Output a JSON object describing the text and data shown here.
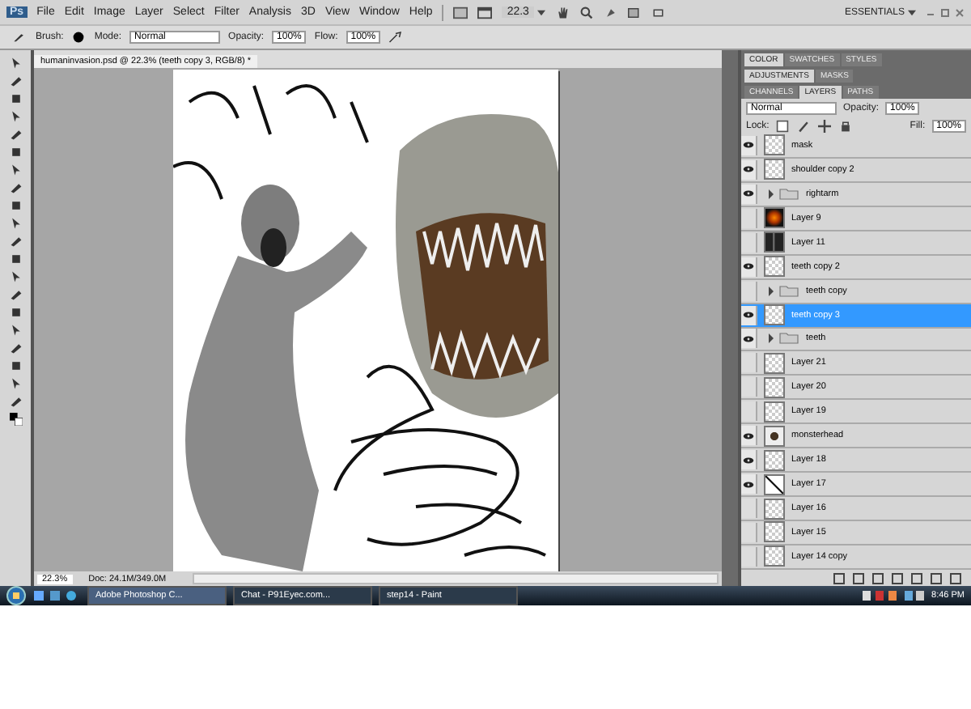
{
  "app": {
    "logo": "Ps",
    "menus": [
      "File",
      "Edit",
      "Image",
      "Layer",
      "Select",
      "Filter",
      "Analysis",
      "3D",
      "View",
      "Window",
      "Help"
    ],
    "zoom": "22.3",
    "workspace": "ESSENTIALS"
  },
  "options": {
    "brush_label": "Brush:",
    "mode_label": "Mode:",
    "mode": "Normal",
    "opacity_label": "Opacity:",
    "opacity": "100%",
    "flow_label": "Flow:",
    "flow": "100%"
  },
  "document": {
    "tab": "humaninvasion.psd @ 22.3% (teeth copy 3, RGB/8) *",
    "zoom": "22.3%",
    "info": "Doc: 24.1M/349.0M"
  },
  "panel_groups": [
    [
      {
        "label": "COLOR",
        "selected": true
      },
      {
        "label": "SWATCHES",
        "selected": false
      },
      {
        "label": "STYLES",
        "selected": false
      }
    ],
    [
      {
        "label": "ADJUSTMENTS",
        "selected": true
      },
      {
        "label": "MASKS",
        "selected": false
      }
    ],
    [
      {
        "label": "CHANNELS",
        "selected": false
      },
      {
        "label": "LAYERS",
        "selected": true
      },
      {
        "label": "PATHS",
        "selected": false
      }
    ]
  ],
  "layers_panel": {
    "blend": "Normal",
    "opacity_label": "Opacity:",
    "opacity": "100%",
    "lock_label": "Lock:",
    "fill_label": "Fill:",
    "fill": "100%",
    "layers": [
      {
        "kind": "blank",
        "name": "mask",
        "visible": true,
        "selected": false
      },
      {
        "kind": "blank",
        "name": "shoulder copy 2",
        "visible": true,
        "selected": false
      },
      {
        "kind": "group",
        "name": "rightarm",
        "visible": true,
        "selected": false
      },
      {
        "kind": "fire",
        "name": "Layer 9",
        "visible": false,
        "selected": false
      },
      {
        "kind": "dark",
        "name": "Layer 11",
        "visible": false,
        "selected": false
      },
      {
        "kind": "blank",
        "name": "teeth copy 2",
        "visible": true,
        "selected": false
      },
      {
        "kind": "group",
        "name": "teeth copy",
        "visible": false,
        "selected": false
      },
      {
        "kind": "blank",
        "name": "teeth copy 3",
        "visible": true,
        "selected": true
      },
      {
        "kind": "group",
        "name": "teeth",
        "visible": true,
        "selected": false
      },
      {
        "kind": "blank",
        "name": "Layer 21",
        "visible": false,
        "selected": false
      },
      {
        "kind": "blank",
        "name": "Layer 20",
        "visible": false,
        "selected": false
      },
      {
        "kind": "blank",
        "name": "Layer 19",
        "visible": false,
        "selected": false
      },
      {
        "kind": "head",
        "name": "monsterhead",
        "visible": true,
        "selected": false
      },
      {
        "kind": "blank",
        "name": "Layer 18",
        "visible": true,
        "selected": false
      },
      {
        "kind": "sketch",
        "name": "Layer 17",
        "visible": true,
        "selected": false
      },
      {
        "kind": "blank",
        "name": "Layer 16",
        "visible": false,
        "selected": false
      },
      {
        "kind": "blank",
        "name": "Layer 15",
        "visible": false,
        "selected": false
      },
      {
        "kind": "blank",
        "name": "Layer 14 copy",
        "visible": false,
        "selected": false
      }
    ]
  },
  "taskbar": {
    "tasks": [
      {
        "label": "Adobe Photoshop C...",
        "selected": true
      },
      {
        "label": "Chat - P91Eyec.com...",
        "selected": false
      },
      {
        "label": "step14 - Paint",
        "selected": false
      }
    ],
    "clock": "8:46 PM"
  }
}
